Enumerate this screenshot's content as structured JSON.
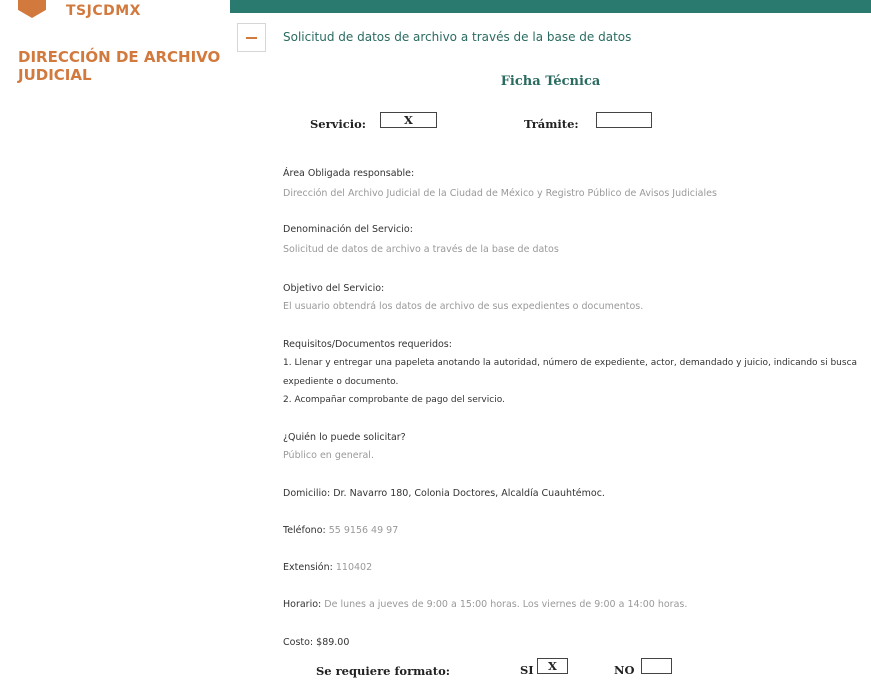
{
  "sidebar": {
    "logo_text": "TSJCDMX",
    "title": "DIRECCIÓN DE ARCHIVO JUDICIAL"
  },
  "accordion": {
    "title": "Solicitud de datos de archivo a través de la base de datos"
  },
  "ficha": {
    "heading": "Ficha Técnica",
    "servicio_label": "Servicio:",
    "servicio_value": "X",
    "tramite_label": "Trámite:",
    "tramite_value": ""
  },
  "fields": {
    "area_label": "Área Obligada responsable:",
    "area_value": "Dirección del Archivo Judicial de la Ciudad de México y Registro Público de Avisos Judiciales",
    "denominacion_label": "Denominación del Servicio:",
    "denominacion_value": "Solicitud de datos de archivo a través de la base de datos",
    "objetivo_label": "Objetivo del Servicio:",
    "objetivo_value": "El usuario obtendrá los datos de archivo de sus expedientes o documentos.",
    "requisitos_label": "Requisitos/Documentos requeridos:",
    "requisitos_1a": "1. Llenar y entregar una papeleta anotando la autoridad, número de expediente, actor, demandado y juicio, indicando si busca",
    "requisitos_1b": "expediente o documento.",
    "requisitos_2": "2. Acompañar comprobante de pago del servicio.",
    "quien_label": "¿Quién lo puede solicitar?",
    "quien_value": "Público en general.",
    "domicilio": "Domicilio: Dr. Navarro 180, Colonia Doctores, Alcaldía Cuauhtémoc.",
    "telefono_label": "Teléfono:",
    "telefono_value": "55 9156 49 97",
    "extension_label": "Extensión:",
    "extension_value": "110402",
    "horario_label": "Horario:",
    "horario_value": "De lunes a jueves de 9:00 a 15:00 horas. Los viernes de 9:00 a 14:00 horas.",
    "costo": "Costo: $89.00"
  },
  "formato": {
    "label": "Se requiere formato:",
    "si_label": "SI",
    "si_value": "X",
    "no_label": "NO",
    "no_value": ""
  }
}
